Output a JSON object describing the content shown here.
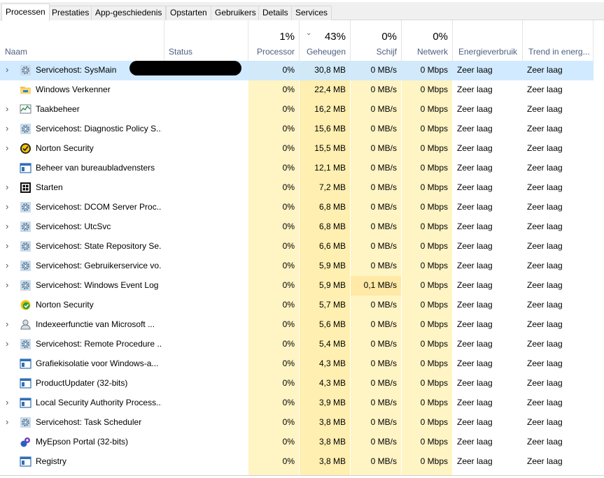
{
  "tabs": [
    {
      "label": "Processen"
    },
    {
      "label": "Prestaties"
    },
    {
      "label": "App-geschiedenis"
    },
    {
      "label": "Opstarten"
    },
    {
      "label": "Gebruikers"
    },
    {
      "label": "Details"
    },
    {
      "label": "Services"
    }
  ],
  "header": {
    "name": "Naam",
    "status": "Status",
    "cpu_pct": "1%",
    "cpu": "Processor",
    "mem_pct": "43%",
    "mem": "Geheugen",
    "disk_pct": "0%",
    "disk": "Schijf",
    "net_pct": "0%",
    "net": "Netwerk",
    "power": "Energieverbruik",
    "trend": "Trend in energ..."
  },
  "colors": {
    "cpu_bg": "#fff4c4",
    "mem_bg": "#ffefb0",
    "disk_bg": "#fff4c4",
    "net_bg": "#fff4c4",
    "selected": "#cce8ff",
    "disk_highlight": "#ffe9a6"
  },
  "rows": [
    {
      "name": "Servicehost: SysMain",
      "icon": "gear-icon",
      "expandable": true,
      "cpu": "0%",
      "mem": "30,8 MB",
      "disk": "0 MB/s",
      "net": "0 Mbps",
      "power": "Zeer laag",
      "trend": "Zeer laag"
    },
    {
      "name": "Windows Verkenner",
      "icon": "folder-icon",
      "expandable": false,
      "cpu": "0%",
      "mem": "22,4 MB",
      "disk": "0 MB/s",
      "net": "0 Mbps",
      "power": "Zeer laag",
      "trend": "Zeer laag"
    },
    {
      "name": "Taakbeheer",
      "icon": "task-manager-icon",
      "expandable": true,
      "cpu": "0%",
      "mem": "16,2 MB",
      "disk": "0 MB/s",
      "net": "0 Mbps",
      "power": "Zeer laag",
      "trend": "Zeer laag"
    },
    {
      "name": "Servicehost: Diagnostic Policy S...",
      "icon": "gear-icon",
      "expandable": true,
      "cpu": "0%",
      "mem": "15,6 MB",
      "disk": "0 MB/s",
      "net": "0 Mbps",
      "power": "Zeer laag",
      "trend": "Zeer laag"
    },
    {
      "name": "Norton Security",
      "icon": "norton-icon",
      "expandable": true,
      "cpu": "0%",
      "mem": "15,5 MB",
      "disk": "0 MB/s",
      "net": "0 Mbps",
      "power": "Zeer laag",
      "trend": "Zeer laag"
    },
    {
      "name": "Beheer van bureaubladvensters",
      "icon": "window-icon",
      "expandable": false,
      "cpu": "0%",
      "mem": "12,1 MB",
      "disk": "0 MB/s",
      "net": "0 Mbps",
      "power": "Zeer laag",
      "trend": "Zeer laag"
    },
    {
      "name": "Starten",
      "icon": "start-icon",
      "expandable": true,
      "cpu": "0%",
      "mem": "7,2 MB",
      "disk": "0 MB/s",
      "net": "0 Mbps",
      "power": "Zeer laag",
      "trend": "Zeer laag"
    },
    {
      "name": "Servicehost: DCOM Server Proc...",
      "icon": "gear-icon",
      "expandable": true,
      "cpu": "0%",
      "mem": "6,8 MB",
      "disk": "0 MB/s",
      "net": "0 Mbps",
      "power": "Zeer laag",
      "trend": "Zeer laag"
    },
    {
      "name": "Servicehost: UtcSvc",
      "icon": "gear-icon",
      "expandable": true,
      "cpu": "0%",
      "mem": "6,8 MB",
      "disk": "0 MB/s",
      "net": "0 Mbps",
      "power": "Zeer laag",
      "trend": "Zeer laag"
    },
    {
      "name": "Servicehost: State Repository Se...",
      "icon": "gear-icon",
      "expandable": true,
      "cpu": "0%",
      "mem": "6,6 MB",
      "disk": "0 MB/s",
      "net": "0 Mbps",
      "power": "Zeer laag",
      "trend": "Zeer laag"
    },
    {
      "name": "Servicehost: Gebruikerservice vo...",
      "icon": "gear-icon",
      "expandable": true,
      "cpu": "0%",
      "mem": "5,9 MB",
      "disk": "0 MB/s",
      "net": "0 Mbps",
      "power": "Zeer laag",
      "trend": "Zeer laag"
    },
    {
      "name": "Servicehost: Windows Event Log",
      "icon": "gear-icon",
      "expandable": true,
      "cpu": "0%",
      "mem": "5,9 MB",
      "disk": "0,1 MB/s",
      "net": "0 Mbps",
      "power": "Zeer laag",
      "trend": "Zeer laag"
    },
    {
      "name": "Norton Security",
      "icon": "norton-check-icon",
      "expandable": false,
      "cpu": "0%",
      "mem": "5,7 MB",
      "disk": "0 MB/s",
      "net": "0 Mbps",
      "power": "Zeer laag",
      "trend": "Zeer laag"
    },
    {
      "name": "Indexeerfunctie van Microsoft ...",
      "icon": "indexer-icon",
      "expandable": true,
      "cpu": "0%",
      "mem": "5,6 MB",
      "disk": "0 MB/s",
      "net": "0 Mbps",
      "power": "Zeer laag",
      "trend": "Zeer laag"
    },
    {
      "name": "Servicehost: Remote Procedure ...",
      "icon": "gear-icon",
      "expandable": true,
      "cpu": "0%",
      "mem": "5,4 MB",
      "disk": "0 MB/s",
      "net": "0 Mbps",
      "power": "Zeer laag",
      "trend": "Zeer laag"
    },
    {
      "name": "Grafiekisolatie voor Windows-a...",
      "icon": "window-icon",
      "expandable": false,
      "cpu": "0%",
      "mem": "4,3 MB",
      "disk": "0 MB/s",
      "net": "0 Mbps",
      "power": "Zeer laag",
      "trend": "Zeer laag"
    },
    {
      "name": "ProductUpdater (32-bits)",
      "icon": "window-icon",
      "expandable": false,
      "cpu": "0%",
      "mem": "4,3 MB",
      "disk": "0 MB/s",
      "net": "0 Mbps",
      "power": "Zeer laag",
      "trend": "Zeer laag"
    },
    {
      "name": "Local Security Authority Process...",
      "icon": "window-icon",
      "expandable": true,
      "cpu": "0%",
      "mem": "3,9 MB",
      "disk": "0 MB/s",
      "net": "0 Mbps",
      "power": "Zeer laag",
      "trend": "Zeer laag"
    },
    {
      "name": "Servicehost: Task Scheduler",
      "icon": "gear-icon",
      "expandable": true,
      "cpu": "0%",
      "mem": "3,8 MB",
      "disk": "0 MB/s",
      "net": "0 Mbps",
      "power": "Zeer laag",
      "trend": "Zeer laag"
    },
    {
      "name": "MyEpson Portal (32-bits)",
      "icon": "epson-icon",
      "expandable": false,
      "cpu": "0%",
      "mem": "3,8 MB",
      "disk": "0 MB/s",
      "net": "0 Mbps",
      "power": "Zeer laag",
      "trend": "Zeer laag"
    },
    {
      "name": "Registry",
      "icon": "window-icon",
      "expandable": false,
      "cpu": "0%",
      "mem": "3,8 MB",
      "disk": "0 MB/s",
      "net": "0 Mbps",
      "power": "Zeer laag",
      "trend": "Zeer laag"
    }
  ]
}
